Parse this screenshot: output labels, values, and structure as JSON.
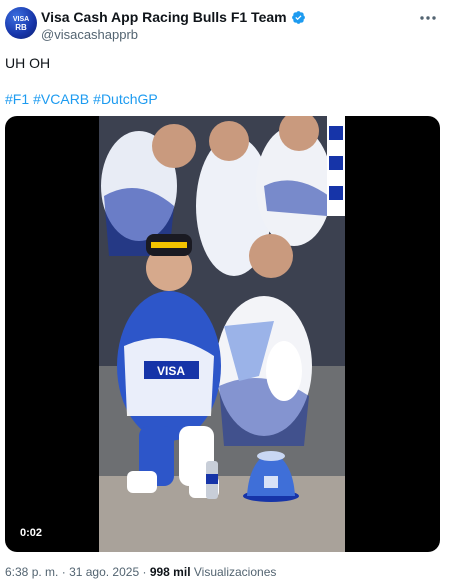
{
  "account": {
    "display_name": "Visa Cash App Racing Bulls F1 Team",
    "handle": "@visacashapprb",
    "avatar_icon": "team-logo-avatar",
    "verified_icon": "verified-badge-icon",
    "verified_color": "#1d9bf0"
  },
  "tweet": {
    "text": "UH OH",
    "hashtags": [
      "#F1",
      "#VCARB",
      "#DutchGP"
    ]
  },
  "media": {
    "type": "video",
    "duration": "0:02"
  },
  "footer": {
    "time": "6:38 p. m.",
    "separator": "·",
    "date": "31 ago. 2025",
    "views_count": "998 mil",
    "views_label": "Visualizaciones"
  },
  "colors": {
    "link": "#1d9bf0",
    "secondary_text": "#536471",
    "brand_blue": "#1634a8"
  }
}
